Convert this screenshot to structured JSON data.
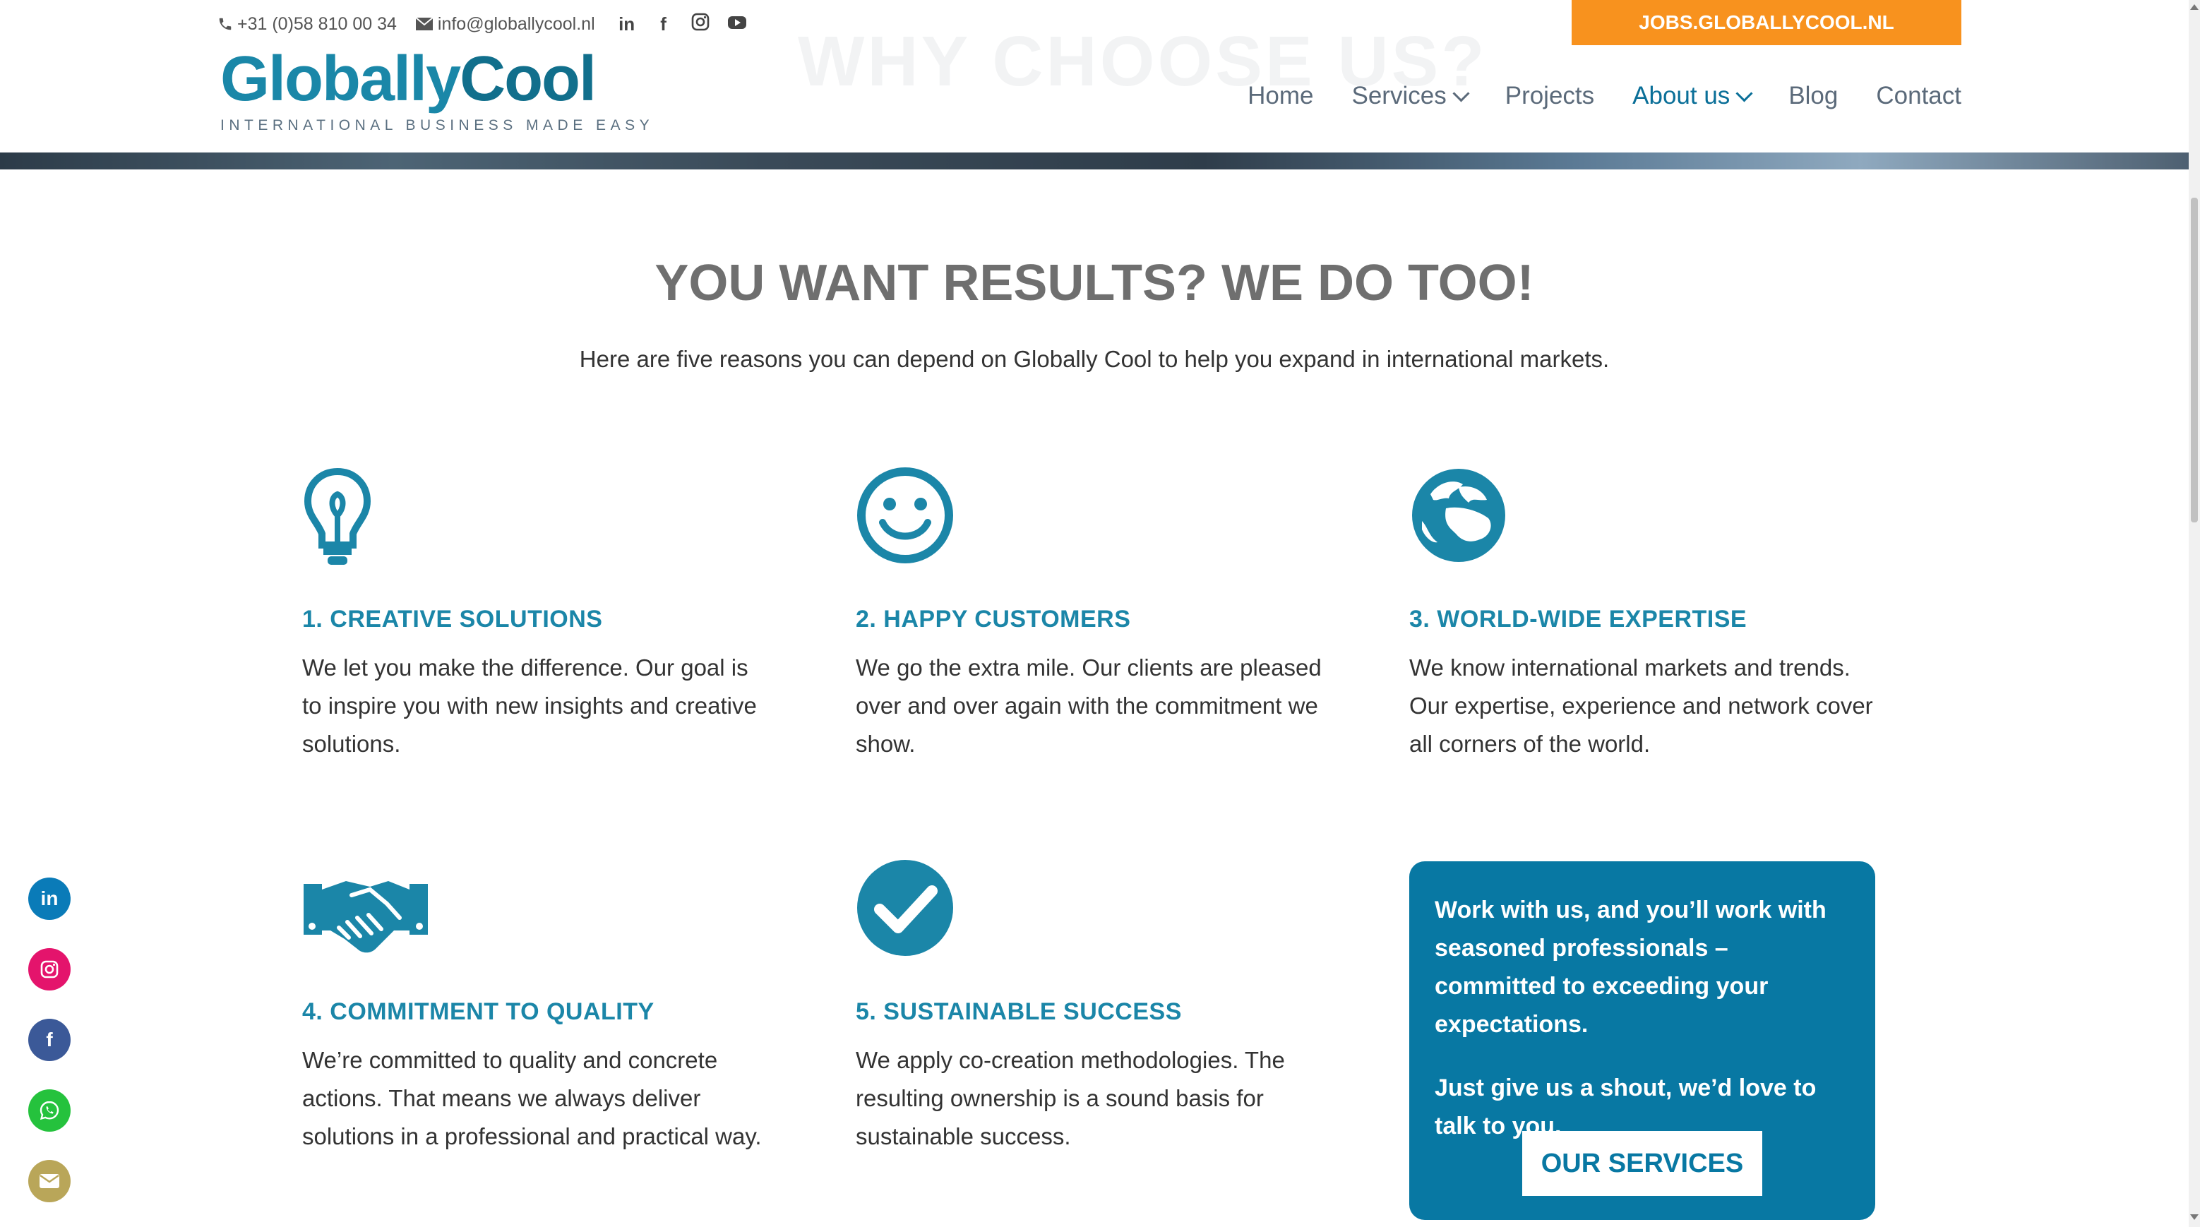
{
  "header": {
    "phone": "+31 (0)58 810 00 34",
    "email": "info@globallycool.nl",
    "jobs_button": "JOBS.GLOBALLYCOOL.NL",
    "ghost_title": "WHY CHOOSE US?",
    "logo": {
      "part1": "Globally",
      "part2": "Cool",
      "tagline": "INTERNATIONAL BUSINESS MADE EASY"
    },
    "social_icons": [
      "linkedin-icon",
      "facebook-icon",
      "instagram-icon",
      "youtube-icon"
    ],
    "nav": [
      {
        "label": "Home",
        "dropdown": false,
        "active": false
      },
      {
        "label": "Services",
        "dropdown": true,
        "active": false
      },
      {
        "label": "Projects",
        "dropdown": false,
        "active": false
      },
      {
        "label": "About us",
        "dropdown": true,
        "active": true
      },
      {
        "label": "Blog",
        "dropdown": false,
        "active": false
      },
      {
        "label": "Contact",
        "dropdown": false,
        "active": false
      }
    ]
  },
  "main": {
    "heading": "YOU WANT RESULTS? WE DO TOO!",
    "intro": "Here are five reasons you can depend on Globally Cool to help you expand in international markets.",
    "features": [
      {
        "icon": "lightbulb-icon",
        "title": "1. CREATIVE SOLUTIONS",
        "text": "We let you make the difference. Our goal is to inspire you with new insights and creative solutions."
      },
      {
        "icon": "smiley-icon",
        "title": "2. HAPPY CUSTOMERS",
        "text": "We go the extra mile. Our clients are pleased over and over again with the commitment we show."
      },
      {
        "icon": "globe-icon",
        "title": "3. WORLD-WIDE EXPERTISE",
        "text": "We know international markets and trends. Our expertise, experience and network cover all corners of the world."
      },
      {
        "icon": "handshake-icon",
        "title": "4. COMMITMENT TO QUALITY",
        "text": "We’re committed to quality and concrete actions. That means we always deliver solutions in a professional and practical way."
      },
      {
        "icon": "checkmark-icon",
        "title": "5. SUSTAINABLE SUCCESS",
        "text": "We apply co-creation methodologies. The resulting ownership is a sound basis for sustainable success."
      }
    ],
    "cta": {
      "text1": "Work with us, and you’ll work with seasoned professionals – committed to exceeding your expectations.",
      "text2": "Just give us a shout, we’d love to talk to you.",
      "button": "OUR SERVICES"
    }
  },
  "share_bar": [
    {
      "icon": "linkedin-icon",
      "color": "#0a7bb8"
    },
    {
      "icon": "instagram-icon",
      "color": "#e4146c"
    },
    {
      "icon": "facebook-icon",
      "color": "#3b5998"
    },
    {
      "icon": "whatsapp-icon",
      "color": "#25c23d"
    },
    {
      "icon": "email-icon",
      "color": "#b9a659"
    }
  ],
  "colors": {
    "accent": "#1b86a8",
    "cta_bg": "#0878a3",
    "jobs_orange": "#f8921e"
  }
}
